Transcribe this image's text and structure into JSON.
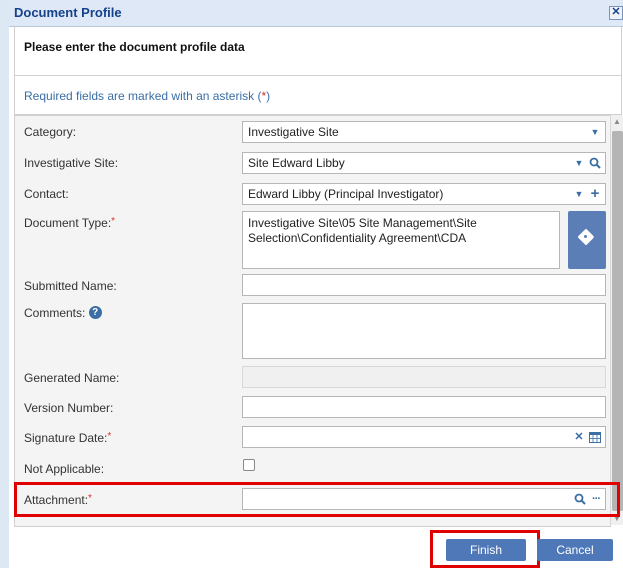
{
  "dialog": {
    "title": "Document Profile",
    "close_glyph": "✕",
    "intro": "Please enter the document profile data",
    "required_note_prefix": "Required fields are marked with an asterisk (",
    "required_note_star": "*",
    "required_note_suffix": ")"
  },
  "fields": {
    "category": {
      "label": "Category:",
      "value": "Investigative Site"
    },
    "investigative_site": {
      "label": "Investigative Site:",
      "value": "Site  Edward Libby"
    },
    "contact": {
      "label": "Contact:",
      "value": "Edward Libby (Principal Investigator)"
    },
    "document_type": {
      "label": "Document Type:",
      "star": "*",
      "value": "Investigative Site\\05 Site Management\\Site Selection\\Confidentiality Agreement\\CDA"
    },
    "submitted_name": {
      "label": "Submitted Name:",
      "value": ""
    },
    "comments": {
      "label": "Comments:",
      "value": ""
    },
    "generated_name": {
      "label": "Generated Name:",
      "value": ""
    },
    "version_number": {
      "label": "Version Number:",
      "value": ""
    },
    "signature_date": {
      "label": "Signature Date:",
      "star": "*",
      "value": ""
    },
    "not_applicable": {
      "label": "Not Applicable:"
    },
    "attachment": {
      "label": "Attachment:",
      "star": "*",
      "value": ""
    }
  },
  "icons": {
    "dropdown": "▼",
    "search": "🔍",
    "add": "+",
    "clear": "✕",
    "more": "···",
    "info": "?"
  },
  "buttons": {
    "finish": "Finish",
    "cancel": "Cancel"
  },
  "colors": {
    "title_text": "#15428b",
    "required_star": "#d9302c",
    "highlight": "#e00000",
    "primary_button": "#4f78b8"
  }
}
